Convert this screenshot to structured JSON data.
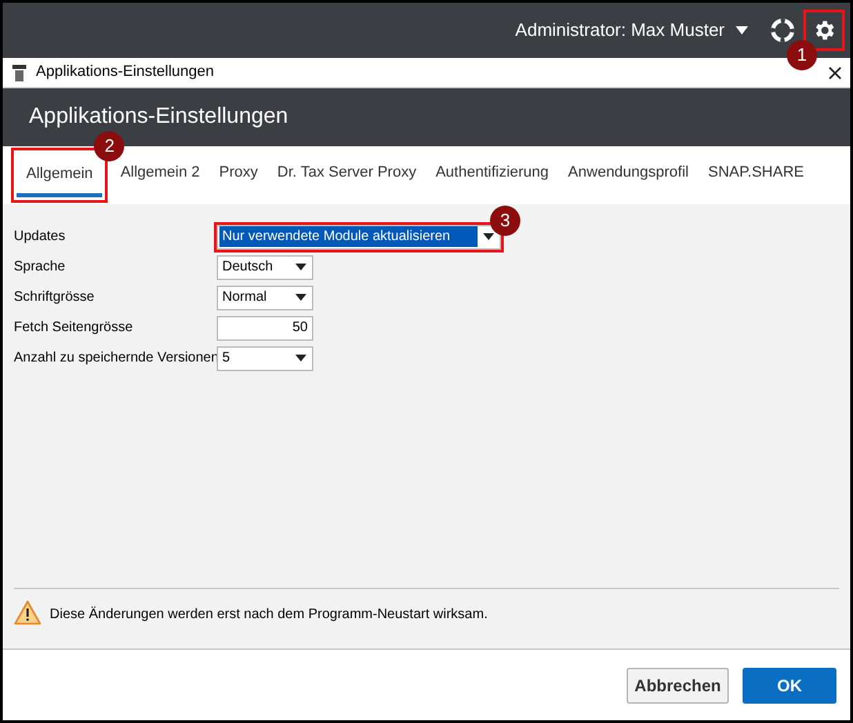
{
  "top_bar": {
    "user": "Administrator: Max Muster",
    "settings_callout": "1"
  },
  "dialog": {
    "title": "Applikations-Einstellungen",
    "header": "Applikations-Einstellungen"
  },
  "tabs": [
    {
      "label": "Allgemein",
      "selected": true,
      "callout": "2"
    },
    {
      "label": "Allgemein 2",
      "selected": false
    },
    {
      "label": "Proxy",
      "selected": false
    },
    {
      "label": "Dr. Tax Server Proxy",
      "selected": false
    },
    {
      "label": "Authentifizierung",
      "selected": false
    },
    {
      "label": "Anwendungsprofil",
      "selected": false
    },
    {
      "label": "SNAP.SHARE",
      "selected": false
    }
  ],
  "fields": [
    {
      "label": "Updates",
      "kind": "select",
      "value": "Nur verwendete Module aktualisieren",
      "highlighted": true,
      "callout": "3"
    },
    {
      "label": "Sprache",
      "kind": "select",
      "value": "Deutsch",
      "highlighted": false
    },
    {
      "label": "Schriftgrösse",
      "kind": "select",
      "value": "Normal",
      "highlighted": false
    },
    {
      "label": "Fetch Seitengrösse",
      "kind": "number",
      "value": "50",
      "highlighted": false
    },
    {
      "label": "Anzahl zu speichernde Versionen",
      "kind": "select",
      "value": "5",
      "highlighted": false
    }
  ],
  "warning": "Diese Änderungen werden erst nach dem Programm-Neustart wirksam.",
  "buttons": [
    {
      "label": "Abbrechen",
      "kind": "secondary"
    },
    {
      "label": "OK",
      "kind": "primary"
    }
  ]
}
